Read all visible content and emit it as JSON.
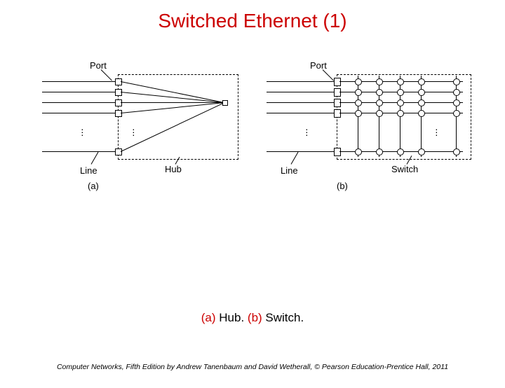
{
  "title": "Switched Ethernet (1)",
  "caption": {
    "prefix_a": "(a)",
    "text_a": " Hub. ",
    "prefix_b": "(b)",
    "text_b": " Switch."
  },
  "footer": "Computer Networks, Fifth Edition by Andrew Tanenbaum and David Wetherall, © Pearson Education-Prentice Hall, 2011",
  "diagram_a": {
    "port_label": "Port",
    "line_label": "Line",
    "device_label": "Hub",
    "subfig_label": "(a)"
  },
  "diagram_b": {
    "port_label": "Port",
    "line_label": "Line",
    "device_label": "Switch",
    "subfig_label": "(b)"
  }
}
